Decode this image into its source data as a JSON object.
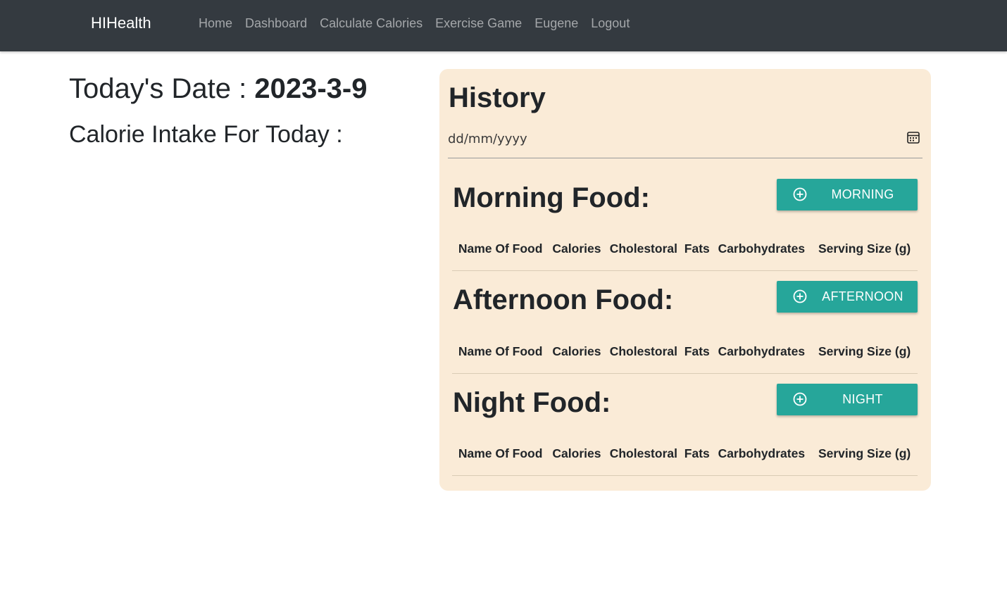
{
  "navbar": {
    "brand": "HIHealth",
    "links": [
      "Home",
      "Dashboard",
      "Calculate Calories",
      "Exercise Game",
      "Eugene",
      "Logout"
    ]
  },
  "today": {
    "label": "Today's Date : ",
    "date": "2023-3-9",
    "intake_label": "Calorie Intake For Today :"
  },
  "history": {
    "title": "History",
    "date_placeholder": "dd/mm/yyyy",
    "columns": [
      "Name Of Food",
      "Calories",
      "Cholestoral",
      "Fats",
      "Carbohydrates",
      "Serving Size (g)"
    ],
    "sections": [
      {
        "title": "Morning Food:",
        "button": "MORNING"
      },
      {
        "title": "Afternoon Food:",
        "button": "AFTERNOON"
      },
      {
        "title": "Night Food:",
        "button": "NIGHT"
      }
    ]
  },
  "colors": {
    "navbar_bg": "#343a40",
    "card_bg": "#faebd7",
    "button_bg": "#26a69a"
  }
}
